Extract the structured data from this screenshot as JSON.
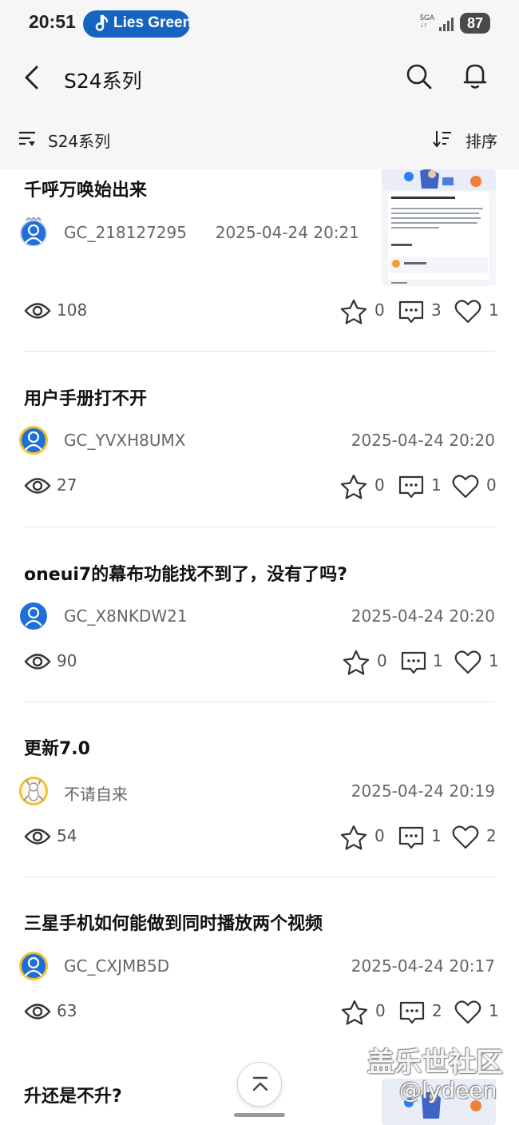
{
  "status_bar": {
    "time": "20:51",
    "media_song": "Lies Greens",
    "network": "5GA",
    "battery": "87"
  },
  "header": {
    "title": "S24系列"
  },
  "filter_bar": {
    "filter_label": "S24系列",
    "sort_label": "排序"
  },
  "posts": [
    {
      "title": "千呼万唤始出来",
      "author": "GC_218127295",
      "date": "2025-04-24 20:21",
      "views": "108",
      "favorites": "0",
      "comments": "3",
      "likes": "1",
      "has_thumbnail": true
    },
    {
      "title": "用户手册打不开",
      "author": "GC_YVXH8UMX",
      "date": "2025-04-24 20:20",
      "views": "27",
      "favorites": "0",
      "comments": "1",
      "likes": "0",
      "has_thumbnail": false
    },
    {
      "title": "oneui7的幕布功能找不到了，没有了吗?",
      "author": "GC_X8NKDW21",
      "date": "2025-04-24 20:20",
      "views": "90",
      "favorites": "0",
      "comments": "1",
      "likes": "1",
      "has_thumbnail": false
    },
    {
      "title": "更新7.0",
      "author": "不请自来",
      "date": "2025-04-24 20:19",
      "views": "54",
      "favorites": "0",
      "comments": "1",
      "likes": "2",
      "has_thumbnail": false
    },
    {
      "title": "三星手机如何能做到同时播放两个视频",
      "author": "GC_CXJMB5D",
      "date": "2025-04-24 20:17",
      "views": "63",
      "favorites": "0",
      "comments": "2",
      "likes": "1",
      "has_thumbnail": false
    },
    {
      "title": "升还是不升?",
      "has_thumbnail": true
    }
  ],
  "watermark": {
    "site": "盖乐世社区",
    "handle": "@lydeen"
  },
  "colors": {
    "accent_blue": "#1565c0",
    "avatar_blue": "#1e6fd9",
    "avatar_ring": "#f2c230"
  }
}
